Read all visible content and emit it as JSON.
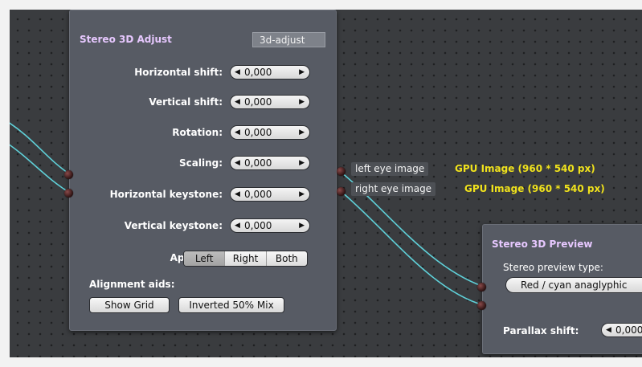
{
  "adjust_node": {
    "title": "Stereo 3D Adjust",
    "id_label": "3d-adjust",
    "params": [
      {
        "label": "Horizontal shift:",
        "value": "0,000"
      },
      {
        "label": "Vertical shift:",
        "value": "0,000"
      },
      {
        "label": "Rotation:",
        "value": "0,000"
      },
      {
        "label": "Scaling:",
        "value": "0,000"
      },
      {
        "label": "Horizontal keystone:",
        "value": "0,000"
      },
      {
        "label": "Vertical keystone:",
        "value": "0,000"
      }
    ],
    "apply_to": {
      "label": "Apply to:",
      "options": [
        "Left",
        "Right",
        "Both"
      ],
      "selected": "Left"
    },
    "alignment_aids": {
      "label": "Alignment aids:",
      "show_grid": "Show Grid",
      "inverted_mix": "Inverted 50% Mix"
    },
    "outputs": [
      {
        "name": "left eye image",
        "type": "GPU Image (960 * 540 px)"
      },
      {
        "name": "right eye image",
        "type": "GPU Image (960 * 540 px)"
      }
    ]
  },
  "preview_node": {
    "title": "Stereo 3D Preview",
    "preview_type_label": "Stereo preview type:",
    "preview_type_value": "Red / cyan anaglyphic",
    "parallax_label": "Parallax shift:",
    "parallax_value": "0,000"
  },
  "colors": {
    "canvas": "#3a3c3f",
    "node": "#575b64",
    "title": "#e7c8ff",
    "wire": "#5fd0d8",
    "type_text": "#f0e21c"
  }
}
